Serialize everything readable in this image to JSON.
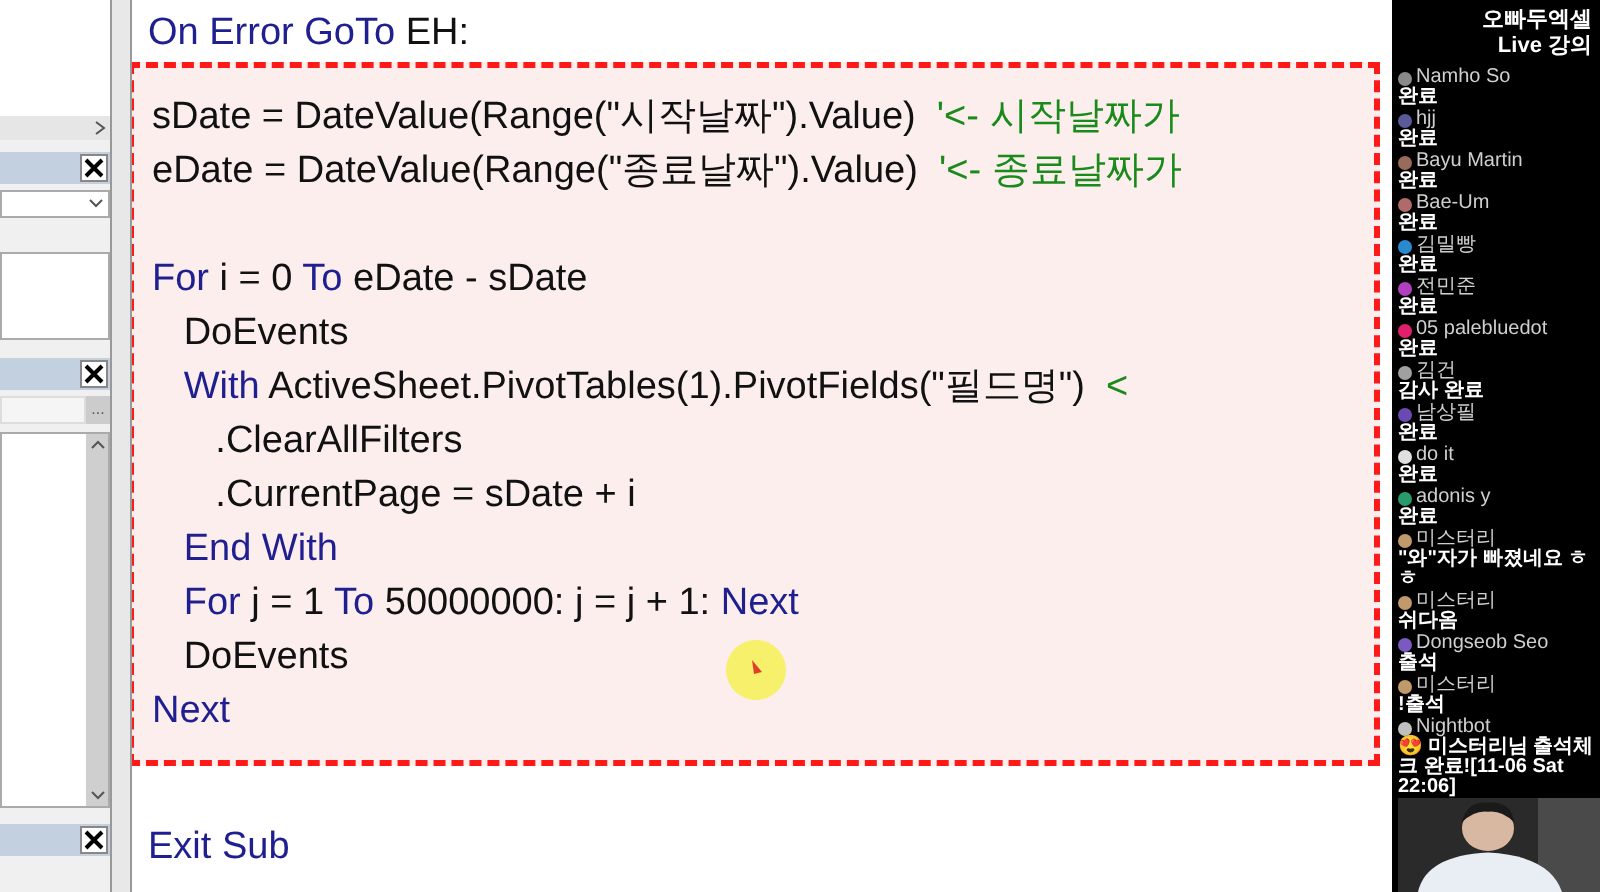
{
  "left_panel": {
    "browse_button": "..."
  },
  "code": {
    "before": [
      [
        {
          "kind": "keyword",
          "text": "On Error GoTo "
        },
        {
          "kind": "plain",
          "text": "EH:"
        }
      ]
    ],
    "highlighted": [
      [
        {
          "kind": "plain",
          "text": "sDate = DateValue(Range(\"시작날짜\").Value)  "
        },
        {
          "kind": "comment",
          "text": "'<- 시작날짜가"
        }
      ],
      [
        {
          "kind": "plain",
          "text": "eDate = DateValue(Range(\"종료날짜\").Value)  "
        },
        {
          "kind": "comment",
          "text": "'<- 종료날짜가"
        }
      ],
      [
        {
          "kind": "keyword",
          "text": "For "
        },
        {
          "kind": "plain",
          "text": "i = 0 "
        },
        {
          "kind": "keyword",
          "text": "To "
        },
        {
          "kind": "plain",
          "text": "eDate - sDate"
        }
      ],
      [
        {
          "kind": "plain",
          "text": "   DoEvents"
        }
      ],
      [
        {
          "kind": "keyword",
          "text": "   With "
        },
        {
          "kind": "plain",
          "text": "ActiveSheet.PivotTables(1).PivotFields(\"필드명\")  "
        },
        {
          "kind": "comment",
          "text": "<"
        }
      ],
      [
        {
          "kind": "plain",
          "text": "      .ClearAllFilters"
        }
      ],
      [
        {
          "kind": "plain",
          "text": "      .CurrentPage = sDate + i"
        }
      ],
      [
        {
          "kind": "keyword",
          "text": "   End With"
        }
      ],
      [
        {
          "kind": "keyword",
          "text": "   For "
        },
        {
          "kind": "plain",
          "text": "j = 1 "
        },
        {
          "kind": "keyword",
          "text": "To "
        },
        {
          "kind": "plain",
          "text": "50000000: j = j + 1: "
        },
        {
          "kind": "keyword",
          "text": "Next"
        }
      ],
      [
        {
          "kind": "plain",
          "text": "   DoEvents"
        }
      ],
      [
        {
          "kind": "keyword",
          "text": "Next"
        }
      ]
    ],
    "after": [
      [
        {
          "kind": "keyword",
          "text": "Exit Sub"
        }
      ]
    ]
  },
  "chat": {
    "title": [
      "오빠두엑셀",
      "Live 강의"
    ],
    "messages": [
      {
        "author": "Namho So",
        "text": "완료",
        "color": "#8a8a8a"
      },
      {
        "author": "hjj",
        "text": "완료",
        "color": "#5a5a9a"
      },
      {
        "author": "Bayu Martin",
        "text": "완료",
        "color": "#9a6a5a"
      },
      {
        "author": "Bae-Um",
        "text": "완료",
        "color": "#b06a6a"
      },
      {
        "author": "김밀빵",
        "text": "완료",
        "color": "#2a8ad0"
      },
      {
        "author": "전민준",
        "text": "완료",
        "color": "#b040c0"
      },
      {
        "author": "05 palebluedot",
        "text": "완료",
        "color": "#e0206a"
      },
      {
        "author": "김건",
        "text": "감사 완료",
        "color": "#a0a0a0"
      },
      {
        "author": "남상필",
        "text": "완료",
        "color": "#6a4ab0"
      },
      {
        "author": "do it",
        "text": "완료",
        "color": "#e0e0e0"
      },
      {
        "author": "adonis y",
        "text": "완료",
        "color": "#2a9a6a"
      },
      {
        "author": "미스터리",
        "text": "\"와\"자가 빠졌네요 ㅎㅎ",
        "color": "#c09a6a"
      },
      {
        "author": "미스터리",
        "text": "쉬다옴",
        "color": "#c09a6a"
      },
      {
        "author": "Dongseob Seo",
        "text": "출석",
        "color": "#7a5ac0"
      },
      {
        "author": "미스터리",
        "text": "!출석",
        "color": "#c09a6a"
      },
      {
        "author": "Nightbot",
        "text": "😍 미스터리님 출석체크 완료![11-06 Sat 22:06]",
        "color": "#c0c0c0"
      }
    ]
  }
}
